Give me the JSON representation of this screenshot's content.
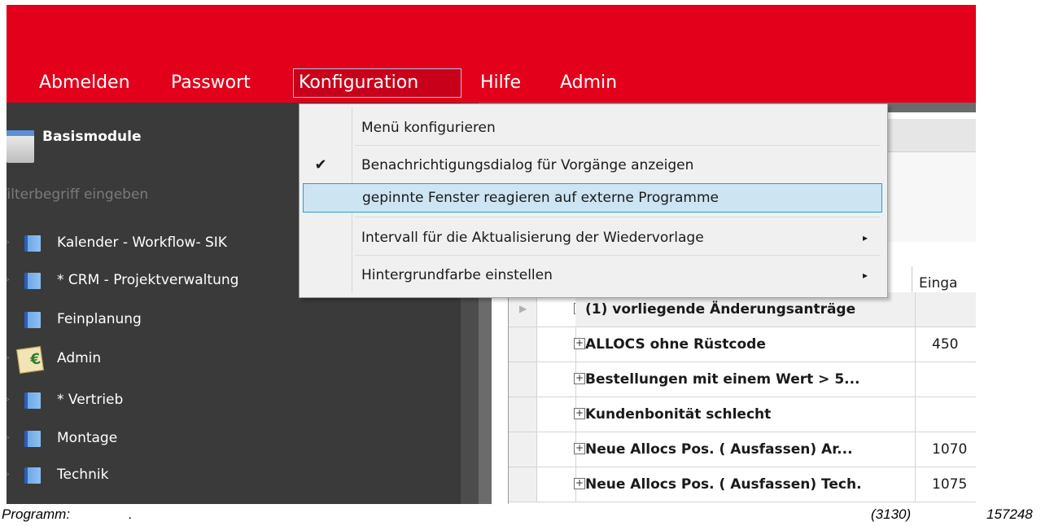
{
  "menubar": {
    "items": [
      "Abmelden",
      "Passwort",
      "Konfiguration",
      "Hilfe",
      "Admin"
    ],
    "active": "Konfiguration",
    "color": "#e3001b"
  },
  "dropdown": {
    "items": [
      {
        "label": "Menü konfigurieren",
        "checked": false,
        "submenu": false
      },
      {
        "label": "Benachrichtigungsdialog für Vorgänge anzeigen",
        "checked": true,
        "submenu": false
      },
      {
        "label": "gepinnte Fenster reagieren auf externe Programme",
        "checked": false,
        "submenu": false,
        "highlighted": true
      },
      {
        "label": "Intervall für die Aktualisierung der Wiedervorlage",
        "checked": false,
        "submenu": true
      },
      {
        "label": "Hintergrundfarbe einstellen",
        "checked": false,
        "submenu": true
      }
    ],
    "check_glyph": "✔",
    "submenu_glyph": "▸"
  },
  "sidebar": {
    "header": "Basismodule",
    "filter_placeholder": "Filterbegriff eingeben",
    "items": [
      {
        "label": "Kalender - Workflow- SIK",
        "icon": "folder-icon"
      },
      {
        "label": "* CRM - Projektverwaltung",
        "icon": "folder-icon"
      },
      {
        "label": "Feinplanung",
        "icon": "folder-icon"
      },
      {
        "label": "Admin",
        "icon": "admin-icon"
      },
      {
        "label": "* Vertrieb",
        "icon": "folder-icon"
      },
      {
        "label": "Montage",
        "icon": "folder-icon"
      },
      {
        "label": "Technik",
        "icon": "folder-icon"
      }
    ]
  },
  "grid": {
    "column_header": "Einga",
    "rows": [
      {
        "name": "(1) vorliegende Änderungsanträge",
        "value": "",
        "group": true
      },
      {
        "name": "ALLOCS ohne Rüstcode",
        "value": "450"
      },
      {
        "name": "Bestellungen mit einem Wert > 5...",
        "value": ""
      },
      {
        "name": "Kundenbonität schlecht",
        "value": ""
      },
      {
        "name": "Neue Allocs Pos. ( Ausfassen)  Ar...",
        "value": "1070"
      },
      {
        "name": "Neue Allocs Pos. ( Ausfassen)  Tech.",
        "value": "1075"
      }
    ]
  },
  "statusbar": {
    "program_label": "Programm:",
    "program_value": ".",
    "code": "(3130)",
    "number": "157248"
  }
}
